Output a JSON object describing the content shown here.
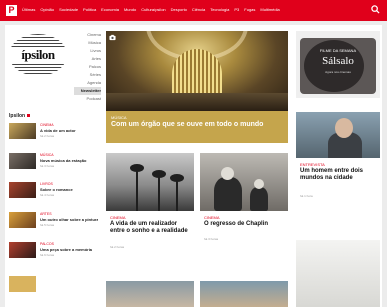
{
  "topbar": {
    "logo": "P",
    "nav": [
      "Últimas",
      "Opinião",
      "Sociedade",
      "Política",
      "Economia",
      "Mundo",
      "Culturaípsilon",
      "Desporto",
      "Ciência",
      "Tecnologia",
      "P3",
      "Fugas",
      "Multimédia"
    ],
    "accent": "#e0001b"
  },
  "masthead": {
    "word": "ípsilon"
  },
  "categories": [
    "Cinema",
    "Música",
    "Livros",
    "Artes",
    "Palcos",
    "Séries",
    "Agenda",
    "Newsletter",
    "Podcast"
  ],
  "hero": {
    "kicker": "MÚSICA",
    "title": "Com um órgão que se ouve em todo o mundo"
  },
  "ad": {
    "top": "FILME DA SEMANA",
    "name": "Sálsalo",
    "bottom": "Agora nos cinemas"
  },
  "sidebar": {
    "heading": "Ipsilon",
    "items": [
      {
        "kicker": "CINEMA",
        "title": "A vida de um actor",
        "meta": "há 2 horas"
      },
      {
        "kicker": "MÚSICA",
        "title": "Nova música da estação",
        "meta": "há 3 horas"
      },
      {
        "kicker": "LIVROS",
        "title": "Sobre o romance",
        "meta": "há 4 horas"
      },
      {
        "kicker": "ARTES",
        "title": "Um outro olhar sobre a pintura",
        "meta": "há 5 horas"
      },
      {
        "kicker": "PALCOS",
        "title": "Uma peça sobre a memória",
        "meta": "há 6 horas"
      }
    ]
  },
  "cards": [
    {
      "kicker": "CINEMA",
      "title": "A vida de um realizador entre o sonho e a realidade",
      "meta": "há 2 horas"
    },
    {
      "kicker": "CINEMA",
      "title": "O regresso de Chaplin",
      "meta": "há 3 horas"
    },
    {
      "kicker": "ENTREVISTA",
      "title": "Um homem entre dois mundos na cidade",
      "meta": "há 1 hora"
    }
  ]
}
